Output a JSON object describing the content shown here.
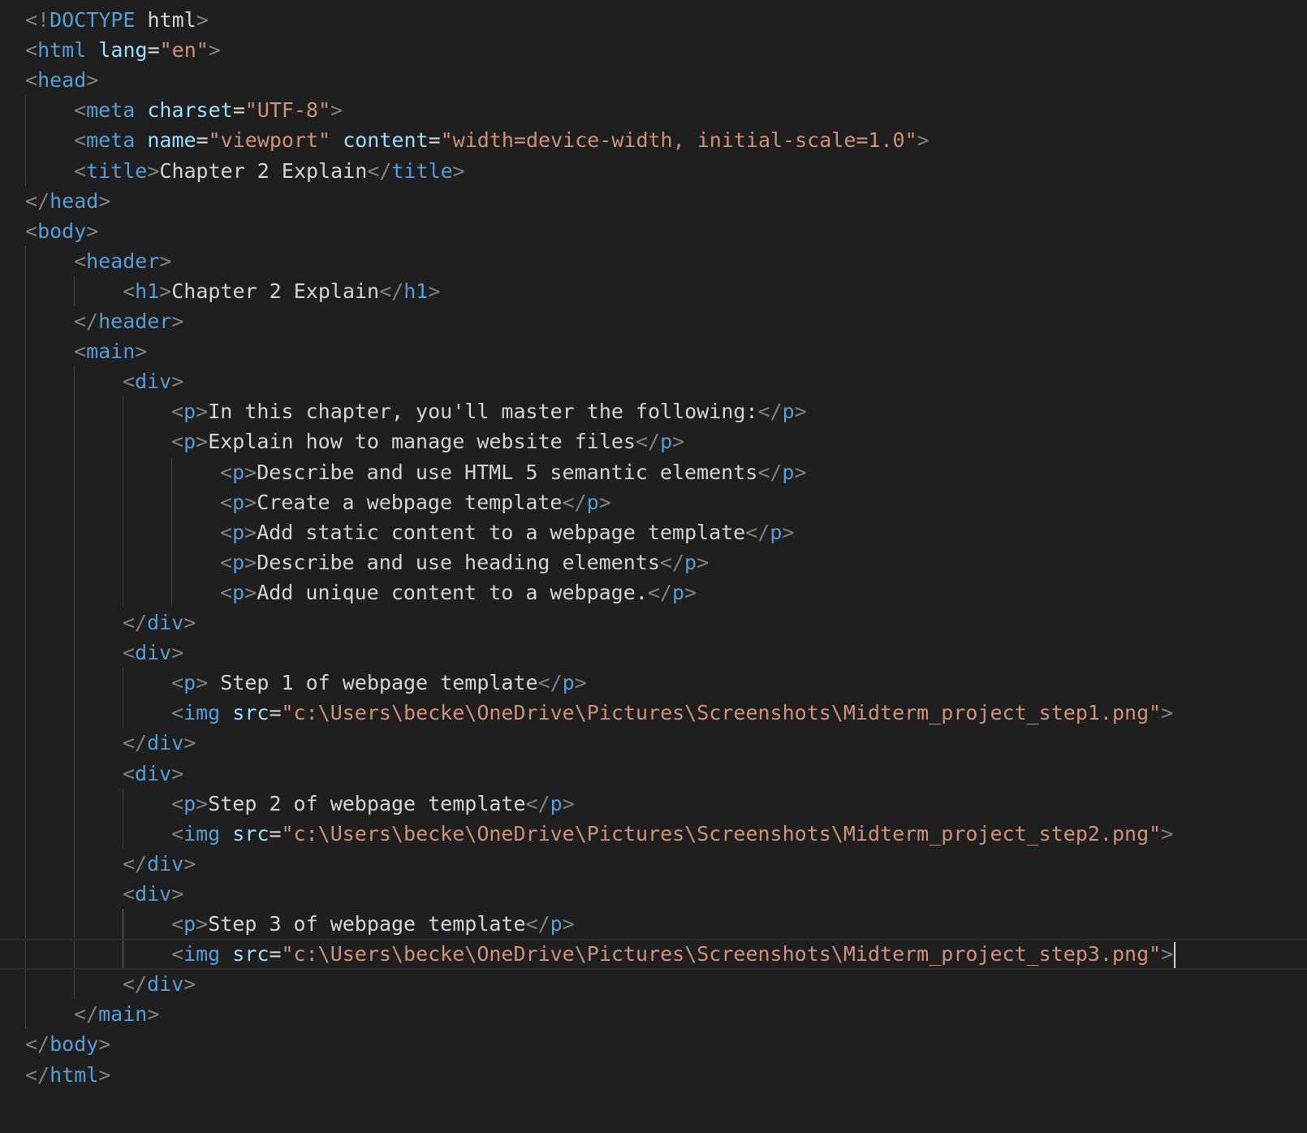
{
  "editor": {
    "colors": {
      "background": "#1f1f1f",
      "punctuation": "#808080",
      "tag": "#569cd6",
      "attribute": "#9cdcfe",
      "string": "#ce9178",
      "text": "#d4d4d4"
    },
    "lines": [
      "<!DOCTYPE html>",
      "<html lang=\"en\">",
      "<head>",
      "<meta charset=\"UTF-8\">",
      "<meta name=\"viewport\" content=\"width=device-width, initial-scale=1.0\">",
      "<title>Chapter 2 Explain</title>",
      "</head>",
      "<body>",
      "<header>",
      "<h1>Chapter 2 Explain</h1>",
      "</header>",
      "<main>",
      "<div>",
      "<p>In this chapter, you'll master the following:</p>",
      "<p>Explain how to manage website files</p>",
      "<p>Describe and use HTML 5 semantic elements</p>",
      "<p>Create a webpage template</p>",
      "<p>Add static content to a webpage template</p>",
      "<p>Describe and use heading elements</p>",
      "<p>Add unique content to a webpage.</p>",
      "</div>",
      "<div>",
      "<p> Step 1 of webpage template</p>",
      "<img src=\"c:\\Users\\becke\\OneDrive\\Pictures\\Screenshots\\Midterm_project_step1.png\">",
      "</div>",
      "<div>",
      "<p>Step 2 of webpage template</p>",
      "<img src=\"c:\\Users\\becke\\OneDrive\\Pictures\\Screenshots\\Midterm_project_step2.png\">",
      "</div>",
      "<div>",
      "<p>Step 3 of webpage template</p>",
      "<img src=\"c:\\Users\\becke\\OneDrive\\Pictures\\Screenshots\\Midterm_project_step3.png\">",
      "</div>",
      "</main>",
      "</body>",
      "</html>"
    ]
  }
}
